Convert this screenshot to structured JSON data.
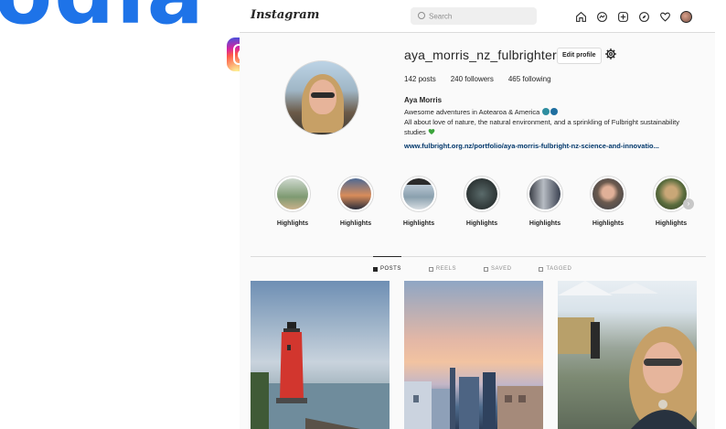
{
  "background_text": "odia",
  "app": {
    "brand": "Instagram"
  },
  "search": {
    "placeholder": "Search"
  },
  "profile": {
    "username": "aya_morris_nz_fulbrighter",
    "edit_label": "Edit profile",
    "stats": {
      "posts": "142 posts",
      "followers": "240 followers",
      "following": "465 following"
    },
    "full_name": "Aya Morris",
    "bio_line1": "Awesome adventures in Aotearoa & America",
    "bio_line2": "All about love of nature, the natural environment, and a sprinkling of Fulbright sustainability studies",
    "link": "www.fulbright.org.nz/portfolio/aya-morris-fulbright-nz-science-and-innovatio..."
  },
  "highlights": [
    {
      "label": "Highlights"
    },
    {
      "label": "Highlights"
    },
    {
      "label": "Highlights"
    },
    {
      "label": "Highlights"
    },
    {
      "label": "Highlights"
    },
    {
      "label": "Highlights"
    },
    {
      "label": "Highlights"
    }
  ],
  "tabs": [
    {
      "label": "POSTS",
      "active": true
    },
    {
      "label": "REELS",
      "active": false
    },
    {
      "label": "SAVED",
      "active": false
    },
    {
      "label": "TAGGED",
      "active": false
    }
  ],
  "colors": {
    "accent_blue": "#1e73e8",
    "link": "#00376b",
    "border": "#dbdbdb"
  }
}
